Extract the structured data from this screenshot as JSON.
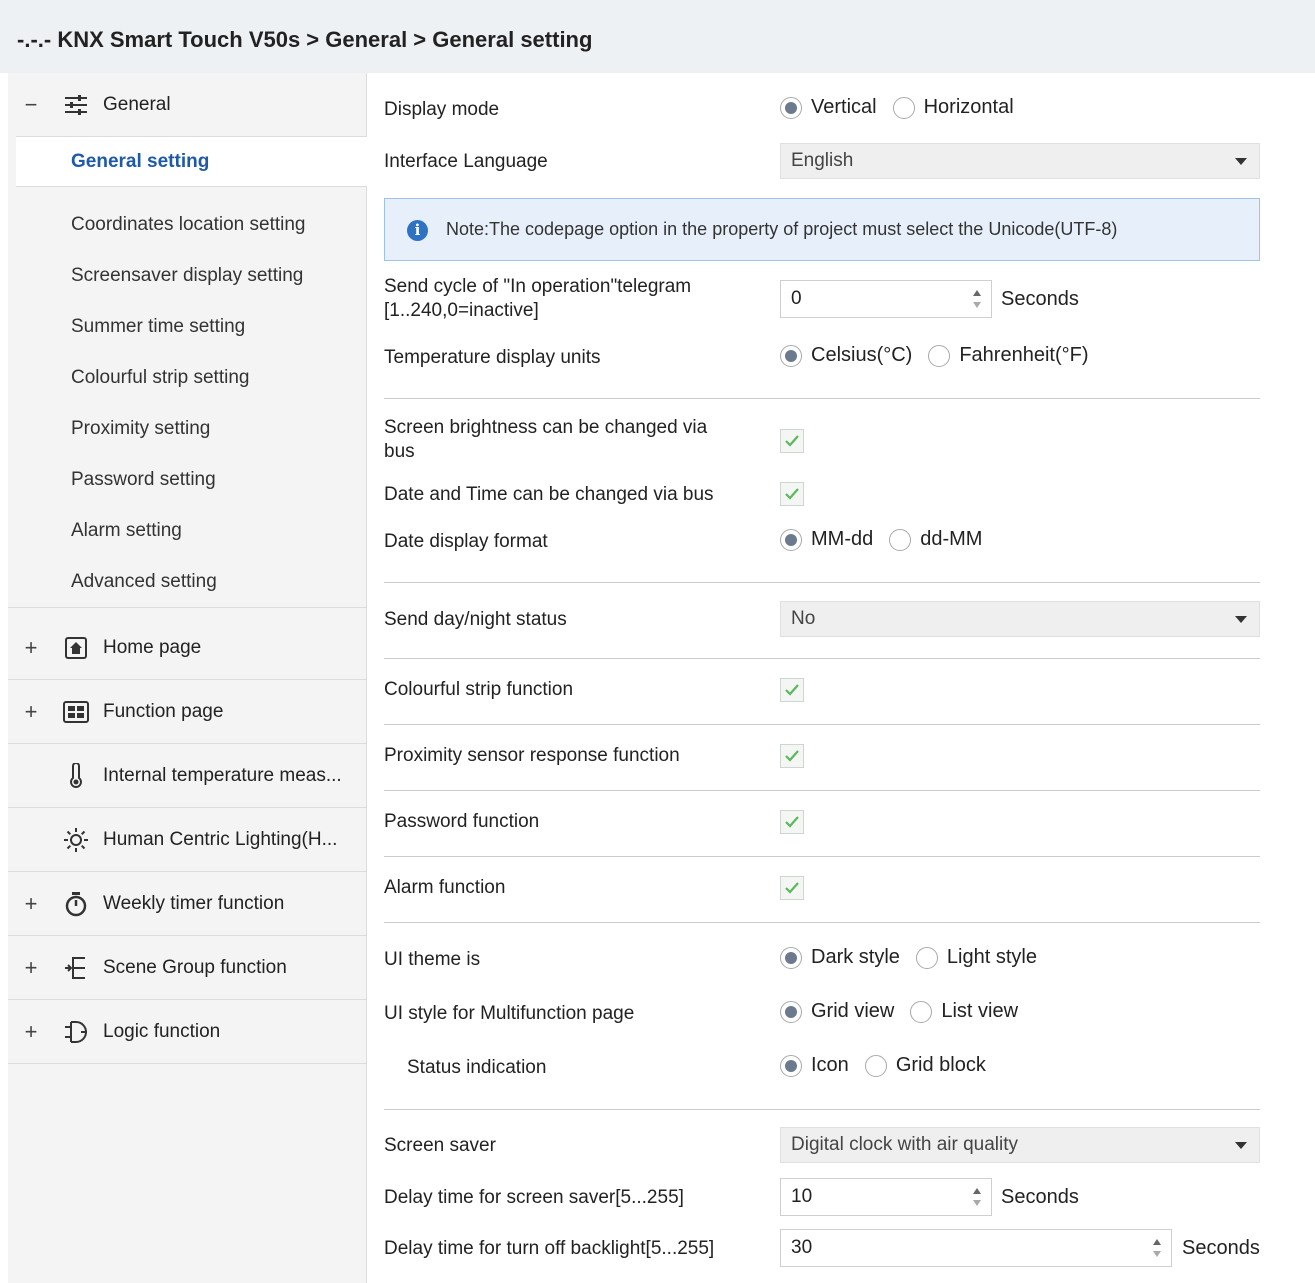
{
  "header": {
    "title": "-.-.- KNX Smart Touch V50s > General > General setting"
  },
  "sidebar": {
    "general": {
      "toggle": "−",
      "label": "General",
      "icon": "sliders-icon"
    },
    "sub_items": [
      "General setting",
      "Coordinates location setting",
      "Screensaver display setting",
      "Summer time setting",
      "Colourful strip setting",
      "Proximity setting",
      "Password setting",
      "Alarm setting",
      "Advanced setting"
    ],
    "active_sub_item": "General setting",
    "groups": [
      {
        "toggle": "+",
        "label": "Home page",
        "icon": "home-icon"
      },
      {
        "toggle": "+",
        "label": "Function page",
        "icon": "function-grid-icon"
      },
      {
        "toggle": "",
        "label": "Internal temperature meas...",
        "icon": "thermometer-icon"
      },
      {
        "toggle": "",
        "label": "Human Centric Lighting(H...",
        "icon": "sun-icon"
      },
      {
        "toggle": "+",
        "label": "Weekly timer function",
        "icon": "timer-icon"
      },
      {
        "toggle": "+",
        "label": "Scene Group function",
        "icon": "scene-icon"
      },
      {
        "toggle": "+",
        "label": "Logic function",
        "icon": "logic-icon"
      }
    ]
  },
  "main": {
    "display_mode": {
      "label": "Display mode",
      "options": [
        "Vertical",
        "Horizontal"
      ],
      "selected": "Vertical"
    },
    "interface_language": {
      "label": "Interface Language",
      "value": "English"
    },
    "note": {
      "text": "Note:The codepage option in the property of project must select the Unicode(UTF-8)"
    },
    "send_cycle": {
      "label_line1": "Send cycle of \"In operation\"telegram",
      "label_line2": "[1..240,0=inactive]",
      "value": "0",
      "unit": "Seconds"
    },
    "temperature_units": {
      "label": "Temperature display units",
      "options": [
        "Celsius(°C)",
        "Fahrenheit(°F)"
      ],
      "selected": "Celsius(°C)"
    },
    "brightness_bus": {
      "label_line1": "Screen brightness can be changed via",
      "label_line2": "bus",
      "checked": true
    },
    "datetime_bus": {
      "label": "Date and Time can be changed via bus",
      "checked": true
    },
    "date_format": {
      "label": "Date display format",
      "options": [
        "MM-dd",
        "dd-MM"
      ],
      "selected": "MM-dd"
    },
    "day_night": {
      "label": "Send day/night status",
      "value": "No"
    },
    "colourful_strip": {
      "label": "Colourful strip function",
      "checked": true
    },
    "proximity": {
      "label": "Proximity sensor response function",
      "checked": true
    },
    "password": {
      "label": "Password function",
      "checked": true
    },
    "alarm": {
      "label": "Alarm function",
      "checked": true
    },
    "ui_theme": {
      "label": "UI theme is",
      "options": [
        "Dark style",
        "Light style"
      ],
      "selected": "Dark style"
    },
    "ui_style": {
      "label": "UI style for Multifunction page",
      "options": [
        "Grid view",
        "List view"
      ],
      "selected": "Grid view"
    },
    "status_indication": {
      "label": "Status indication",
      "options": [
        "Icon",
        "Grid block"
      ],
      "selected": "Icon"
    },
    "screen_saver": {
      "label": "Screen saver",
      "value": "Digital clock with air quality"
    },
    "delay_saver": {
      "label": "Delay time for screen saver[5...255]",
      "value": "10",
      "unit": "Seconds"
    },
    "delay_backlight": {
      "label": "Delay time for turn off backlight[5...255]",
      "value": "30",
      "unit": "Seconds"
    }
  },
  "colors": {
    "accent": "#1e5aa8",
    "title_bg": "#eef1f4",
    "note_bg": "#e7f0fa",
    "check_green": "#5cb85c"
  }
}
